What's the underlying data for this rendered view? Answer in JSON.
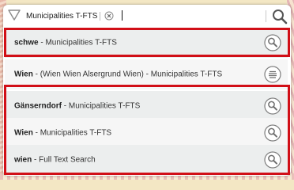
{
  "search": {
    "tag": "Municipalities T-FTS",
    "value": ""
  },
  "results": [
    {
      "bold": "schwe",
      "rest": " - Municipalities T-FTS",
      "icon": "magnifier-icon"
    },
    {
      "bold": "Wien",
      "rest": " - (Wien Wien Alsergrund Wien) - Municipalities T-FTS",
      "icon": "list-icon"
    },
    {
      "bold": "Gänserndorf",
      "rest": " - Municipalities T-FTS",
      "icon": "magnifier-icon"
    },
    {
      "bold": "Wien",
      "rest": " - Municipalities T-FTS",
      "icon": "magnifier-icon"
    },
    {
      "bold": "wien",
      "rest": " - Full Text Search",
      "icon": "magnifier-icon"
    }
  ],
  "colors": {
    "highlight": "#d10f17",
    "row_odd": "#eceeee",
    "row_even": "#f6f6f6"
  }
}
